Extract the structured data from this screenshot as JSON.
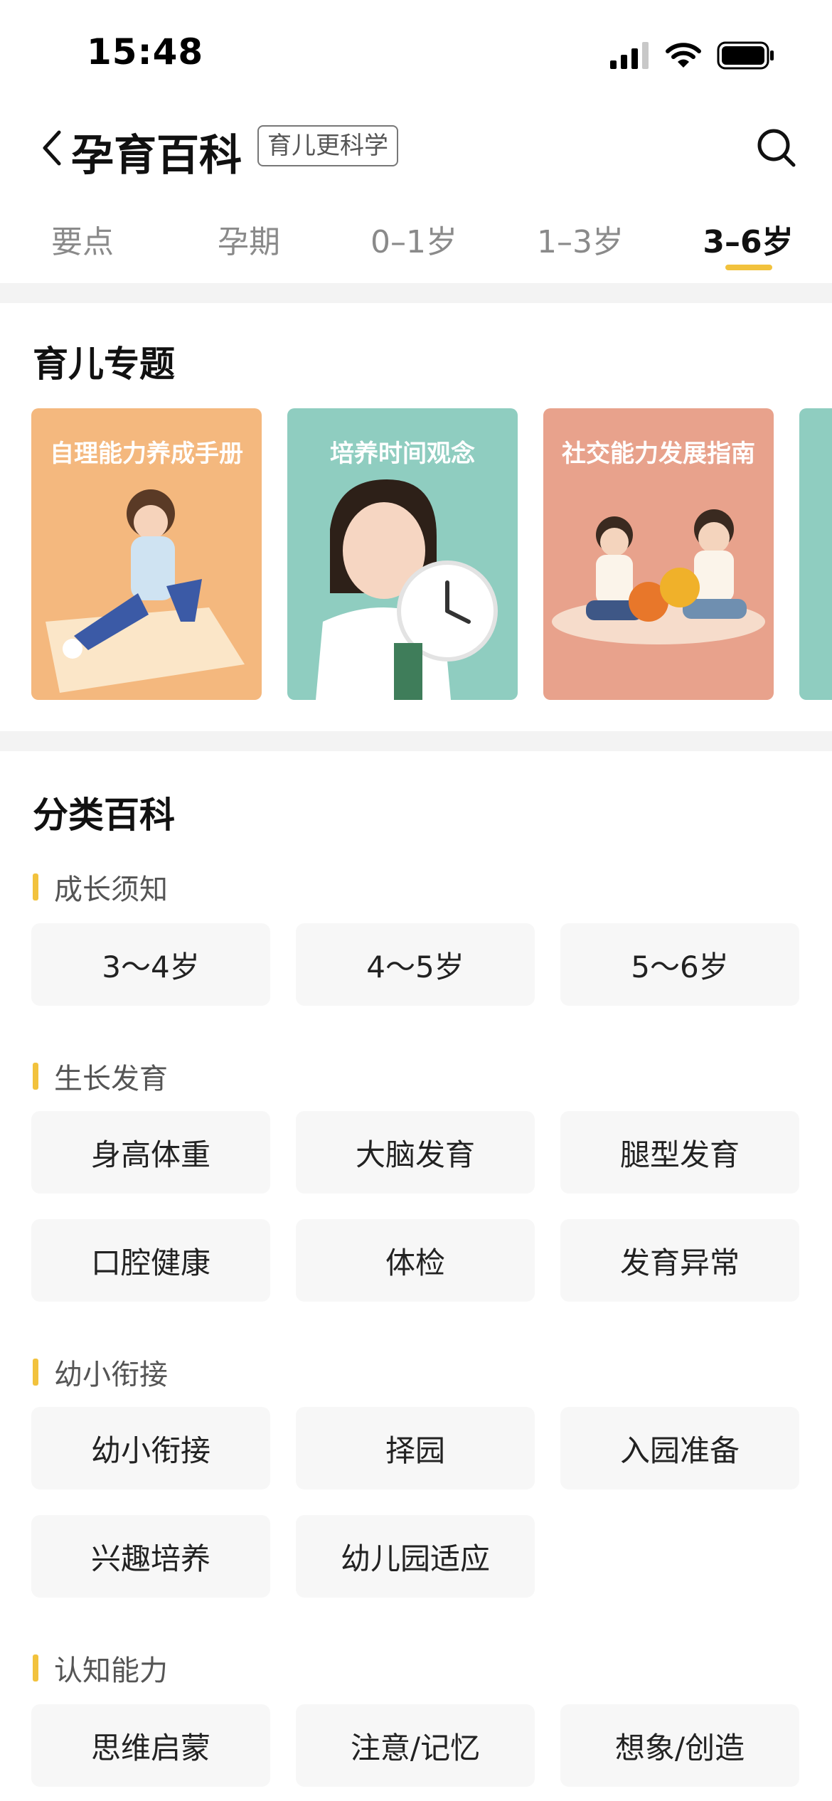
{
  "status_bar": {
    "time": "15:48"
  },
  "nav": {
    "title": "孕育百科",
    "tag": "育儿更科学"
  },
  "tabs": [
    {
      "label": "要点"
    },
    {
      "label": "孕期"
    },
    {
      "label": "0–1岁"
    },
    {
      "label": "1–3岁"
    },
    {
      "label": "3–6岁",
      "active": true
    }
  ],
  "topics": {
    "title": "育儿专题",
    "cards": [
      {
        "title": "自理能力养成手册",
        "color": "#f4b87e"
      },
      {
        "title": "培养时间观念",
        "color": "#8fcdc0"
      },
      {
        "title": "社交能力发展指南",
        "color": "#e8a28c"
      }
    ]
  },
  "categories": {
    "title": "分类百科",
    "groups": [
      {
        "heading": "成长须知",
        "items": [
          "3～4岁",
          "4～5岁",
          "5～6岁"
        ]
      },
      {
        "heading": "生长发育",
        "items": [
          "身高体重",
          "大脑发育",
          "腿型发育",
          "口腔健康",
          "体检",
          "发育异常"
        ]
      },
      {
        "heading": "幼小衔接",
        "items": [
          "幼小衔接",
          "择园",
          "入园准备",
          "兴趣培养",
          "幼儿园适应"
        ]
      },
      {
        "heading": "认知能力",
        "items": [
          "思维启蒙",
          "注意/记忆",
          "想象/创造"
        ]
      }
    ]
  },
  "colors": {
    "accent": "#f2c23d",
    "chip_bg": "#f7f7f7",
    "divider": "#f3f3f3"
  }
}
